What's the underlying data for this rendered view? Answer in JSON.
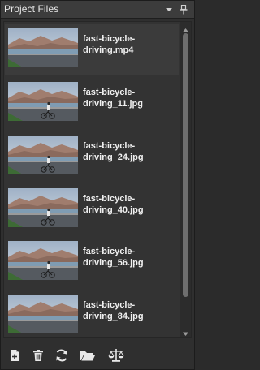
{
  "panel": {
    "title": "Project Files",
    "menu_icon": "dropdown-arrow-icon",
    "pin_icon": "pin-icon"
  },
  "files": [
    {
      "name": "fast-bicycle-driving.mp4",
      "selected": true,
      "rider": false
    },
    {
      "name": "fast-bicycle-driving_11.jpg",
      "selected": false,
      "rider": true
    },
    {
      "name": "fast-bicycle-driving_24.jpg",
      "selected": false,
      "rider": true
    },
    {
      "name": "fast-bicycle-driving_40.jpg",
      "selected": false,
      "rider": true
    },
    {
      "name": "fast-bicycle-driving_56.jpg",
      "selected": false,
      "rider": true
    },
    {
      "name": "fast-bicycle-driving_84.jpg",
      "selected": false,
      "rider": false
    }
  ],
  "toolbar": {
    "icons": [
      "new-file-icon",
      "delete-icon",
      "refresh-icon",
      "open-folder-icon",
      "scales-icon"
    ]
  },
  "colors": {
    "panel_bg": "#2f2f2f",
    "title_bg": "#3c3c3c",
    "text": "#f0f0f0",
    "scroll_thumb": "#6e6e6e"
  }
}
